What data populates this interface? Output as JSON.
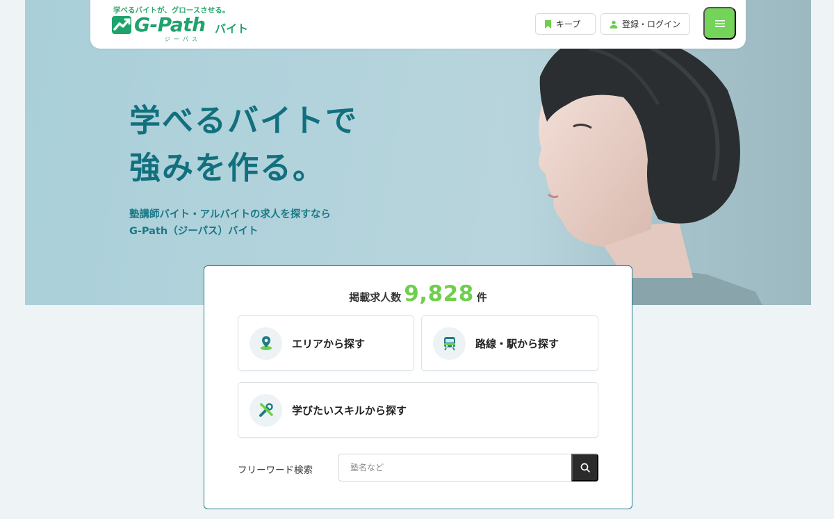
{
  "header": {
    "tagline": "学べるバイトが、グロースさせる。",
    "logo_word": "G-Path",
    "logo_baito": "バイト",
    "logo_ruby": "ジーパス",
    "keep_label": "キープ",
    "login_label": "登録・ログイン"
  },
  "hero": {
    "title_line1": "学べるバイトで",
    "title_line2": "強みを作る。",
    "sub_line1": "塾講師バイト・アルバイトの求人を探すなら",
    "sub_line2": "G-Path（ジーパス）バイト"
  },
  "search": {
    "count_prefix": "掲載求人数",
    "count_value": "9,828",
    "count_suffix": "件",
    "area_label": "エリアから探す",
    "line_label": "路線・駅から探す",
    "skill_label": "学びたいスキルから探す",
    "freeword_label": "フリーワード検索",
    "freeword_placeholder": "塾名など"
  },
  "colors": {
    "brand_green": "#74d45a",
    "logo_green": "#1ea36c",
    "hero_teal": "#12707e",
    "card_border": "#1f7d86"
  },
  "icons": {
    "keep": "bookmark-icon",
    "login": "user-icon",
    "menu": "hamburger-icon",
    "area": "map-pin-icon",
    "line": "train-icon",
    "skill": "tools-icon",
    "search": "search-icon"
  }
}
